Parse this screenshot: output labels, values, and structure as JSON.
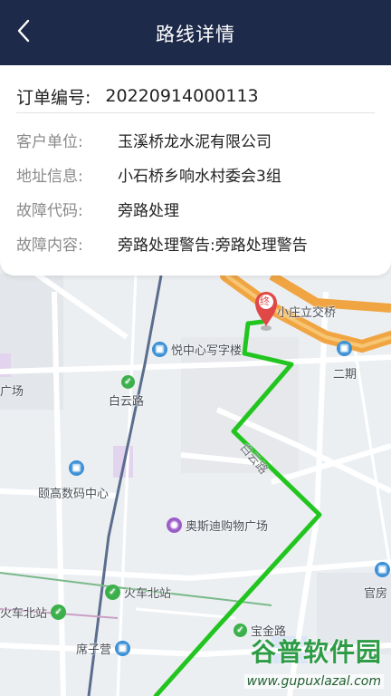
{
  "header": {
    "title": "路线详情",
    "back_icon": "back-arrow-icon"
  },
  "order": {
    "label": "订单编号:",
    "value": "20220914000113"
  },
  "details": [
    {
      "label": "客户单位:",
      "value": "玉溪桥龙水泥有限公司"
    },
    {
      "label": "地址信息:",
      "value": "小石桥乡响水村委会3组"
    },
    {
      "label": "故障代码:",
      "value": "旁路处理"
    },
    {
      "label": "故障内容:",
      "value": "旁路处理警告:旁路处理警告"
    }
  ],
  "map": {
    "end_marker": "终",
    "labels": {
      "xiaozhuang": "小庄立交桥",
      "yuezhongxin": "悦中心写字楼",
      "erqi": "二期",
      "guangchang": "广场",
      "baiyunlu": "白云路",
      "baiyunlu_road": "白云路",
      "yigao": "颐高数码中心",
      "aosidi": "奥斯迪购物广场",
      "huochebeizhan1": "火车北站",
      "huochebeizhan2": "火车北站",
      "guanfang": "官房",
      "xizi": "席子营",
      "baojin": "宝金路"
    },
    "colors": {
      "route": "#22c51f",
      "expressway": "#f0a542",
      "marker": "#e04848",
      "header": "#1e2a4a"
    }
  },
  "watermark": {
    "title": "谷普软件园",
    "url": "www.gupuxlazal.com"
  }
}
